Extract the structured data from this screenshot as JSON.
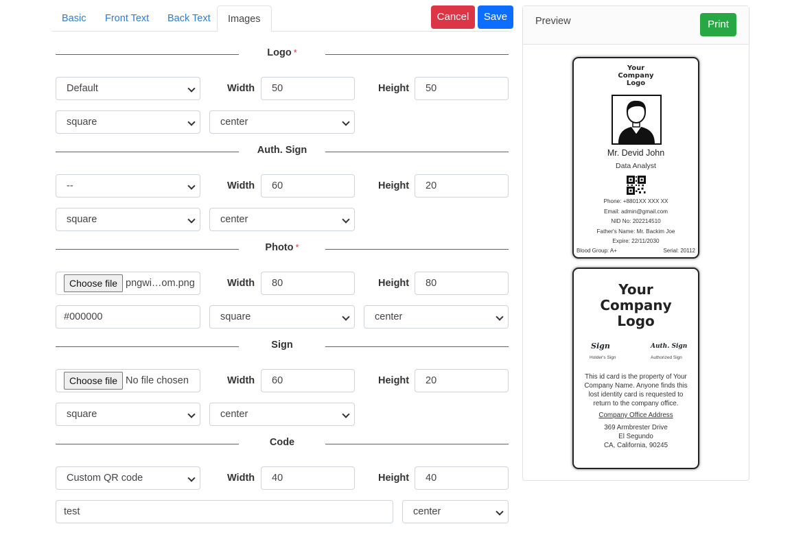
{
  "tabs": [
    {
      "label": "Basic"
    },
    {
      "label": "Front Text"
    },
    {
      "label": "Back Text"
    },
    {
      "label": "Images",
      "active": true
    }
  ],
  "actions": {
    "cancel": "Cancel",
    "save": "Save"
  },
  "labels": {
    "width": "Width",
    "height": "Height",
    "required": "*"
  },
  "logo": {
    "title": "Logo",
    "source": "Default",
    "width": "50",
    "height": "50",
    "shape": "square",
    "align": "center"
  },
  "auth_sign": {
    "title": "Auth. Sign",
    "source": "--",
    "width": "60",
    "height": "20",
    "shape": "square",
    "align": "center"
  },
  "photo": {
    "title": "Photo",
    "file_button": "Choose file",
    "file_name": "pngwi…om.png",
    "width": "80",
    "height": "80",
    "color": "#000000",
    "shape": "square",
    "align": "center"
  },
  "sign": {
    "title": "Sign",
    "file_button": "Choose file",
    "file_name": "No file chosen",
    "width": "60",
    "height": "20",
    "shape": "square",
    "align": "center"
  },
  "code": {
    "title": "Code",
    "source": "Custom QR code",
    "width": "40",
    "height": "40",
    "value": "test",
    "align": "center"
  },
  "preview": {
    "title": "Preview",
    "print": "Print",
    "front": {
      "logo_lines": [
        "Your",
        "Company",
        "Logo"
      ],
      "name": "Mr. Devid John",
      "job": "Data Analyst",
      "details": [
        "Phone: +8801XX XXX XX",
        "Email: admin@gmail.com",
        "NID No: 202214510",
        "Father's Name: Mr. Backim Joe",
        "Expire: 22/11/2030"
      ],
      "blood_group": "Blood Group: A+",
      "serial": "Serial: 20112"
    },
    "back": {
      "logo_lines": [
        "Your",
        "Company",
        "Logo"
      ],
      "sign_title": "Sign",
      "sign_sub": "Holder's Sign",
      "auth_title": "Auth. Sign",
      "auth_sub": "Authorized Sign",
      "property_lines": [
        "This id card is the property of Your",
        "Company Name. Anyone finds this",
        "lost identity card is requested to",
        "return to the company office."
      ],
      "address_heading": "Company Office Address",
      "address_lines": [
        "369 Armbrester Drive",
        "El Segundo",
        "CA, California, 90245"
      ]
    }
  },
  "colors": {
    "cancel": "#dc3545",
    "save": "#0d6efd",
    "print": "#28a745",
    "divider": "#c8342f",
    "tab_link": "#2e7bd0"
  }
}
